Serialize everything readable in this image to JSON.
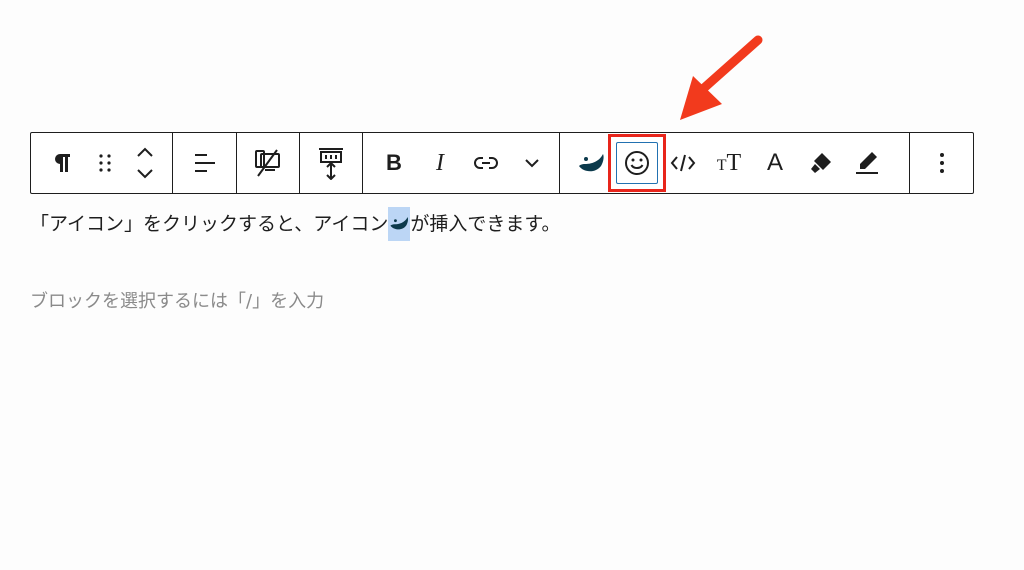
{
  "toolbar": {
    "groups": [
      [
        "paragraph-icon",
        "drag-handle-icon",
        "move-up-down-icon"
      ],
      [
        "align-icon"
      ],
      [
        "hide-on-device-icon"
      ],
      [
        "block-spacing-icon"
      ],
      [
        "bold-button",
        "italic-button",
        "link-button",
        "more-options-chevron"
      ],
      [
        "brand-drop-icon",
        "emoji-icon",
        "code-icon",
        "text-size-icon",
        "text-color-icon",
        "marker-icon",
        "highlight-pen-icon"
      ],
      [
        "kebab-menu-icon"
      ]
    ],
    "bold_label": "B",
    "italic_label": "I",
    "textcolor_label": "A",
    "textsize_small": "T",
    "textsize_large": "T"
  },
  "content": {
    "paragraph_before": "「アイコン」をクリックすると、アイコン",
    "paragraph_after": "が挿入できます。",
    "placeholder": "ブロックを選択するには「/」を入力"
  },
  "colors": {
    "highlight_box": "#e8251b",
    "arrow": "#f23a1d",
    "brand_icon": "#0c3a4c",
    "inline_selection": "#bcd6f5",
    "placeholder_text": "#8a8a8a"
  }
}
